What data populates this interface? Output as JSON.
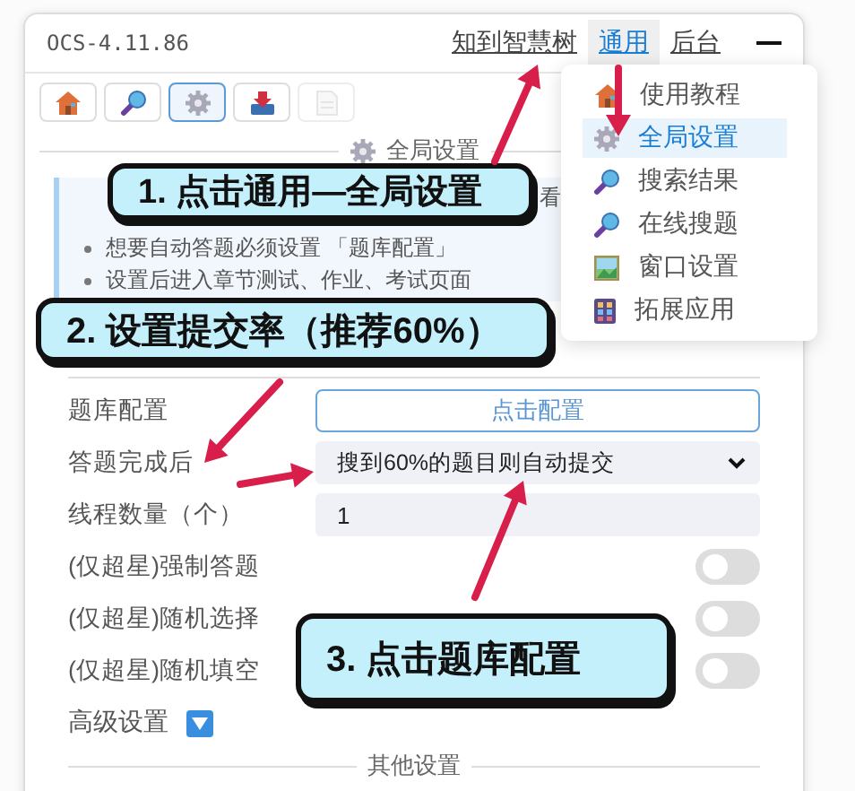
{
  "window": {
    "title": "OCS-4.11.86"
  },
  "nav": [
    {
      "label": "知到智慧树",
      "selected": false
    },
    {
      "label": "通用",
      "selected": true
    },
    {
      "label": "后台",
      "selected": false
    }
  ],
  "toolbar": [
    {
      "kind": "home",
      "selected": false,
      "disabled": false
    },
    {
      "kind": "search",
      "selected": false,
      "disabled": false
    },
    {
      "kind": "gear",
      "selected": true,
      "disabled": false
    },
    {
      "kind": "download",
      "selected": false,
      "disabled": false
    },
    {
      "kind": "document",
      "selected": false,
      "disabled": true
    }
  ],
  "section": {
    "title": "全局设置"
  },
  "notice": [
    {
      "kind": "tail",
      "text": "看"
    },
    {
      "kind": "line",
      "text": "想要自动答题必须设置 「题库配置」"
    },
    {
      "kind": "line",
      "text": "设置后进入章节测试、作业、考试页面"
    }
  ],
  "settings": [
    {
      "kind": "button",
      "label": "题库配置",
      "value": "点击配置"
    },
    {
      "kind": "select",
      "label": "答题完成后",
      "value": "搜到60%的题目则自动提交"
    },
    {
      "kind": "input",
      "label": "线程数量（个）",
      "value": "1"
    },
    {
      "kind": "toggle",
      "label": "(仅超星)强制答题",
      "on": false
    },
    {
      "kind": "toggle",
      "label": "(仅超星)随机选择",
      "on": false
    },
    {
      "kind": "toggle",
      "label": "(仅超星)随机填空",
      "on": false
    }
  ],
  "advanced": {
    "label": "高级设置"
  },
  "next_section": {
    "title": "其他设置"
  },
  "menu": {
    "items": [
      {
        "kind": "home",
        "label": "使用教程",
        "selected": false
      },
      {
        "kind": "gear",
        "label": "全局设置",
        "selected": true
      },
      {
        "kind": "search",
        "label": "搜索结果",
        "selected": false
      },
      {
        "kind": "search",
        "label": "在线搜题",
        "selected": false
      },
      {
        "kind": "picture",
        "label": "窗口设置",
        "selected": false
      },
      {
        "kind": "grid",
        "label": "拓展应用",
        "selected": false
      }
    ]
  },
  "callouts": [
    {
      "text": "1. 点击通用—全局设置"
    },
    {
      "text": "2. 设置提交率（推荐60%）"
    },
    {
      "text": "3. 点击题库配置"
    }
  ]
}
